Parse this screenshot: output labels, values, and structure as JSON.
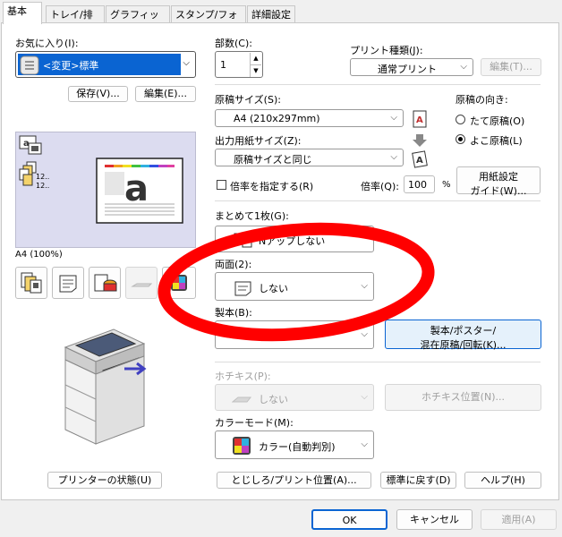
{
  "tabs": [
    "基本",
    "トレイ/排出",
    "グラフィックス",
    "スタンプ/フォーム",
    "詳細設定"
  ],
  "favorites": {
    "label": "お気に入り(I):",
    "value": "<変更>標準",
    "save": "保存(V)...",
    "edit": "編集(E)..."
  },
  "preview": {
    "caption": "A4 (100%)",
    "mini1": "12..",
    "mini2": "12.."
  },
  "copies": {
    "label": "部数(C):",
    "value": "1"
  },
  "print_type": {
    "label": "プリント種類(J):",
    "value": "通常プリント",
    "edit": "編集(T)..."
  },
  "original_size": {
    "label": "原稿サイズ(S):",
    "value": "A4 (210x297mm)"
  },
  "orientation": {
    "label": "原稿の向き:",
    "portrait": "たて原稿(O)",
    "landscape": "よこ原稿(L)",
    "selected": "landscape"
  },
  "output_size": {
    "label": "出力用紙サイズ(Z):",
    "value": "原稿サイズと同じ"
  },
  "paper_setting": {
    "line1": "用紙設定",
    "line2": "ガイド(W)..."
  },
  "scale": {
    "check_label": "倍率を指定する(R)",
    "label": "倍率(Q):",
    "value": "100",
    "unit": "%"
  },
  "nup": {
    "label": "まとめて1枚(G):",
    "value": "Nアップしない"
  },
  "duplex": {
    "label": "両面(2):",
    "value": "しない"
  },
  "booklet": {
    "label": "製本(B):",
    "button_line1": "製本/ポスター/",
    "button_line2": "混在原稿/回転(K)..."
  },
  "staple": {
    "label": "ホチキス(P):",
    "value": "しない",
    "position": "ホチキス位置(N)..."
  },
  "color_mode": {
    "label": "カラーモード(M):",
    "value": "カラー(自動判別)"
  },
  "bottom": {
    "printer_status": "プリンターの状態(U)",
    "margin": "とじしろ/プリント位置(A)...",
    "defaults": "標準に戻す(D)",
    "help": "ヘルプ(H)"
  },
  "dialog": {
    "ok": "OK",
    "cancel": "キャンセル",
    "apply": "適用(A)"
  },
  "colors": {
    "accent": "#0a64d2",
    "annotation": "#ff0000",
    "preview_bg": "#dcdcf0",
    "highlight_btn": "#e5f1fb"
  }
}
